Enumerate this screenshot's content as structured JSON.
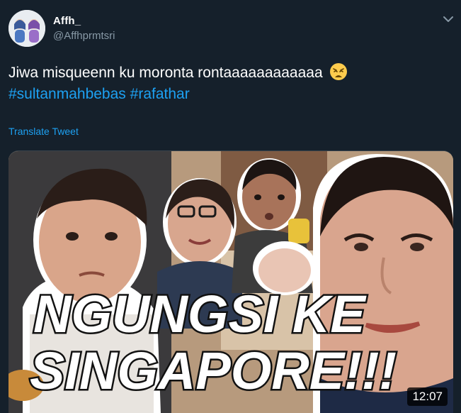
{
  "user": {
    "display_name": "Affh_",
    "handle": "@Affhprmtsri"
  },
  "tweet": {
    "text": "Jiwa misqueenn ku moronta rontaaaaaaaaaaaa",
    "emoji": "weary-face",
    "hashtags": [
      "#sultanmahbebas",
      "#rafathar"
    ],
    "translate_label": "Translate Tweet"
  },
  "media": {
    "title_line1": "NGUNGSI KE",
    "title_line2": "SINGAPORE!!!",
    "duration": "12:07"
  },
  "colors": {
    "background": "#15202b",
    "accent": "#1da1f2",
    "secondary_text": "#8899a6"
  }
}
